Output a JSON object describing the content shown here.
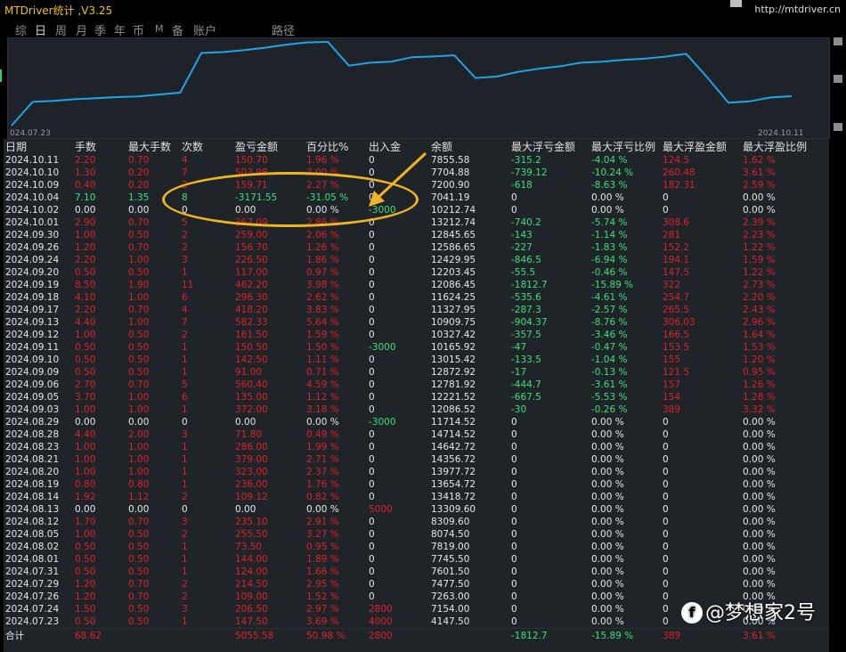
{
  "title": "MTDriver统计 ,V3.25",
  "url": "http://mtdriver.cn",
  "tabs": [
    "综",
    "日",
    "周",
    "月",
    "季",
    "年",
    "币",
    "M",
    "备",
    "账户",
    "路径"
  ],
  "active_tab": "日",
  "chart": {
    "start_date": "024.07.23",
    "end_date": "2024.10.11",
    "line_color": "#1fa4e6",
    "balance_series": [
      4147.5,
      7154.0,
      7263.0,
      7477.5,
      7601.5,
      7745.5,
      7819.0,
      8074.5,
      8309.6,
      13309.6,
      13418.72,
      13654.72,
      13977.72,
      14356.72,
      14642.72,
      14714.52,
      11714.52,
      12086.52,
      12221.52,
      12781.92,
      12872.92,
      13015.42,
      10165.92,
      10327.42,
      10909.75,
      11327.95,
      11624.25,
      12086.45,
      12203.45,
      12429.95,
      12586.65,
      12845.65,
      13212.74,
      10212.74,
      7041.19,
      7200.9,
      7704.88,
      7855.58
    ]
  },
  "table": {
    "headers": [
      "日期",
      "手数",
      "最大手数",
      "次数",
      "盈亏金额",
      "百分比%",
      "出入金",
      "余额",
      "最大浮亏金额",
      "最大浮亏比例",
      "最大浮盈金额",
      "最大浮盈比例"
    ],
    "rows": [
      [
        "2024.10.11",
        "2.20",
        "0.70",
        "4",
        "150.70",
        "1.96 %",
        "0",
        "7855.58",
        "-315.2",
        "-4.04 %",
        "124.5",
        "1.62 %"
      ],
      [
        "2024.10.10",
        "1.30",
        "0.20",
        "7",
        "503.98",
        "7.00 %",
        "0",
        "7704.88",
        "-739.12",
        "-10.24 %",
        "260.48",
        "3.61 %"
      ],
      [
        "2024.10.09",
        "0.40",
        "0.20",
        "2",
        "159.71",
        "2.27 %",
        "0",
        "7200.90",
        "-618",
        "-8.63 %",
        "182.31",
        "2.59 %"
      ],
      [
        "2024.10.04",
        "7.10",
        "1.35",
        "8",
        "-3171.55",
        "-31.05 %",
        "0",
        "7041.19",
        "0",
        "0.00 %",
        "0",
        "0.00 %"
      ],
      [
        "2024.10.02",
        "0.00",
        "0.00",
        "0",
        "0.00",
        "0.00 %",
        "-3000",
        "10212.74",
        "0",
        "0.00 %",
        "0",
        "0.00 %"
      ],
      [
        "2024.10.01",
        "2.90",
        "0.70",
        "5",
        "367.09",
        "2.86 %",
        "0",
        "13212.74",
        "-740.2",
        "-5.74 %",
        "308.6",
        "2.39 %"
      ],
      [
        "2024.09.30",
        "1.00",
        "0.50",
        "2",
        "259.00",
        "2.06 %",
        "0",
        "12845.65",
        "-143",
        "-1.14 %",
        "281",
        "2.23 %"
      ],
      [
        "2024.09.26",
        "1.20",
        "0.70",
        "2",
        "156.70",
        "1.26 %",
        "0",
        "12586.65",
        "-227",
        "-1.83 %",
        "152.2",
        "1.22 %"
      ],
      [
        "2024.09.24",
        "2.20",
        "1.00",
        "3",
        "226.50",
        "1.86 %",
        "0",
        "12429.95",
        "-846.5",
        "-6.94 %",
        "194.1",
        "1.59 %"
      ],
      [
        "2024.09.20",
        "0.50",
        "0.50",
        "1",
        "117.00",
        "0.97 %",
        "0",
        "12203.45",
        "-55.5",
        "-0.46 %",
        "147.5",
        "1.22 %"
      ],
      [
        "2024.09.19",
        "8.50",
        "1.90",
        "11",
        "462.20",
        "3.98 %",
        "0",
        "12086.45",
        "-1812.7",
        "-15.89 %",
        "322",
        "2.73 %"
      ],
      [
        "2024.09.18",
        "4.10",
        "1.00",
        "6",
        "296.30",
        "2.62 %",
        "0",
        "11624.25",
        "-535.6",
        "-4.61 %",
        "254.7",
        "2.20 %"
      ],
      [
        "2024.09.17",
        "2.20",
        "0.70",
        "4",
        "418.20",
        "3.83 %",
        "0",
        "11327.95",
        "-287.3",
        "-2.57 %",
        "265.5",
        "2.43 %"
      ],
      [
        "2024.09.13",
        "4.40",
        "1.00",
        "7",
        "582.33",
        "5.64 %",
        "0",
        "10909.75",
        "-904.37",
        "-8.76 %",
        "306.03",
        "2.96 %"
      ],
      [
        "2024.09.12",
        "1.00",
        "0.50",
        "2",
        "161.50",
        "1.59 %",
        "0",
        "10327.42",
        "-357.5",
        "-3.46 %",
        "166.5",
        "1.64 %"
      ],
      [
        "2024.09.11",
        "0.50",
        "0.50",
        "1",
        "150.50",
        "1.50 %",
        "-3000",
        "10165.92",
        "-47",
        "-0.47 %",
        "153.5",
        "1.53 %"
      ],
      [
        "2024.09.10",
        "0.50",
        "0.50",
        "1",
        "142.50",
        "1.11 %",
        "0",
        "13015.42",
        "-133.5",
        "-1.04 %",
        "155",
        "1.20 %"
      ],
      [
        "2024.09.09",
        "0.50",
        "0.50",
        "1",
        "91.00",
        "0.71 %",
        "0",
        "12872.92",
        "-17",
        "-0.13 %",
        "121.5",
        "0.95 %"
      ],
      [
        "2024.09.06",
        "2.70",
        "0.70",
        "5",
        "560.40",
        "4.59 %",
        "0",
        "12781.92",
        "-444.7",
        "-3.61 %",
        "157",
        "1.26 %"
      ],
      [
        "2024.09.05",
        "3.70",
        "1.00",
        "6",
        "135.00",
        "1.12 %",
        "0",
        "12221.52",
        "-667.5",
        "-5.53 %",
        "154",
        "1.28 %"
      ],
      [
        "2024.09.03",
        "1.00",
        "1.00",
        "1",
        "372.00",
        "3.18 %",
        "0",
        "12086.52",
        "-30",
        "-0.26 %",
        "389",
        "3.32 %"
      ],
      [
        "2024.08.29",
        "0.00",
        "0.00",
        "0",
        "0.00",
        "0.00 %",
        "-3000",
        "11714.52",
        "0",
        "0.00 %",
        "0",
        "0.00 %"
      ],
      [
        "2024.08.28",
        "4.40",
        "2.00",
        "3",
        "71.80",
        "0.49 %",
        "0",
        "14714.52",
        "0",
        "0.00 %",
        "0",
        "0.00 %"
      ],
      [
        "2024.08.23",
        "1.00",
        "1.00",
        "1",
        "286.00",
        "1.99 %",
        "0",
        "14642.72",
        "0",
        "0.00 %",
        "0",
        "0.00 %"
      ],
      [
        "2024.08.21",
        "1.00",
        "1.00",
        "1",
        "379.00",
        "2.71 %",
        "0",
        "14356.72",
        "0",
        "0.00 %",
        "0",
        "0.00 %"
      ],
      [
        "2024.08.20",
        "1.00",
        "1.00",
        "1",
        "323.00",
        "2.37 %",
        "0",
        "13977.72",
        "0",
        "0.00 %",
        "0",
        "0.00 %"
      ],
      [
        "2024.08.19",
        "0.80",
        "0.80",
        "1",
        "236.00",
        "1.76 %",
        "0",
        "13654.72",
        "0",
        "0.00 %",
        "0",
        "0.00 %"
      ],
      [
        "2024.08.14",
        "1.92",
        "1.12",
        "2",
        "109.12",
        "0.82 %",
        "0",
        "13418.72",
        "0",
        "0.00 %",
        "0",
        "0.00 %"
      ],
      [
        "2024.08.13",
        "0.00",
        "0.00",
        "0",
        "0.00",
        "0.00 %",
        "5000",
        "13309.60",
        "0",
        "0.00 %",
        "0",
        "0.00 %"
      ],
      [
        "2024.08.12",
        "1.70",
        "0.70",
        "3",
        "235.10",
        "2.91 %",
        "0",
        "8309.60",
        "0",
        "0.00 %",
        "0",
        "0.00 %"
      ],
      [
        "2024.08.05",
        "1.00",
        "0.50",
        "2",
        "255.50",
        "3.27 %",
        "0",
        "8074.50",
        "0",
        "0.00 %",
        "0",
        "0.00 %"
      ],
      [
        "2024.08.02",
        "0.50",
        "0.50",
        "1",
        "73.50",
        "0.95 %",
        "0",
        "7819.00",
        "0",
        "0.00 %",
        "0",
        "0.00 %"
      ],
      [
        "2024.08.01",
        "0.50",
        "0.50",
        "1",
        "144.00",
        "1.89 %",
        "0",
        "7745.50",
        "0",
        "0.00 %",
        "0",
        "0.00 %"
      ],
      [
        "2024.07.31",
        "0.50",
        "0.50",
        "1",
        "124.00",
        "1.66 %",
        "0",
        "7601.50",
        "0",
        "0.00 %",
        "0",
        "0.00 %"
      ],
      [
        "2024.07.29",
        "1.20",
        "0.70",
        "2",
        "214.50",
        "2.95 %",
        "0",
        "7477.50",
        "0",
        "0.00 %",
        "0",
        "0.00 %"
      ],
      [
        "2024.07.26",
        "1.20",
        "0.70",
        "2",
        "109.00",
        "1.52 %",
        "0",
        "7263.00",
        "0",
        "0.00 %",
        "0",
        "0.00 %"
      ],
      [
        "2024.07.24",
        "1.50",
        "0.50",
        "3",
        "206.50",
        "2.97 %",
        "2800",
        "7154.00",
        "0",
        "0.00 %",
        "0",
        "0.00 %"
      ],
      [
        "2024.07.23",
        "0.50",
        "0.50",
        "1",
        "147.50",
        "3.69 %",
        "4000",
        "4147.50",
        "0",
        "0.00 %",
        "0",
        "0.00 %"
      ]
    ],
    "total": [
      "合计",
      "68.62",
      "",
      "",
      "5055.58",
      "50.98 %",
      "2800",
      "",
      "-1812.7",
      "-15.89 %",
      "389",
      "3.61 %"
    ]
  },
  "watermark": "@梦想家2号",
  "watermark_logo": "f",
  "colors": {
    "profit": "#e0202a",
    "loss": "#39e079",
    "neutral": "#e6e6e6",
    "title": "#f2c200",
    "highlight": "#f0b323"
  }
}
